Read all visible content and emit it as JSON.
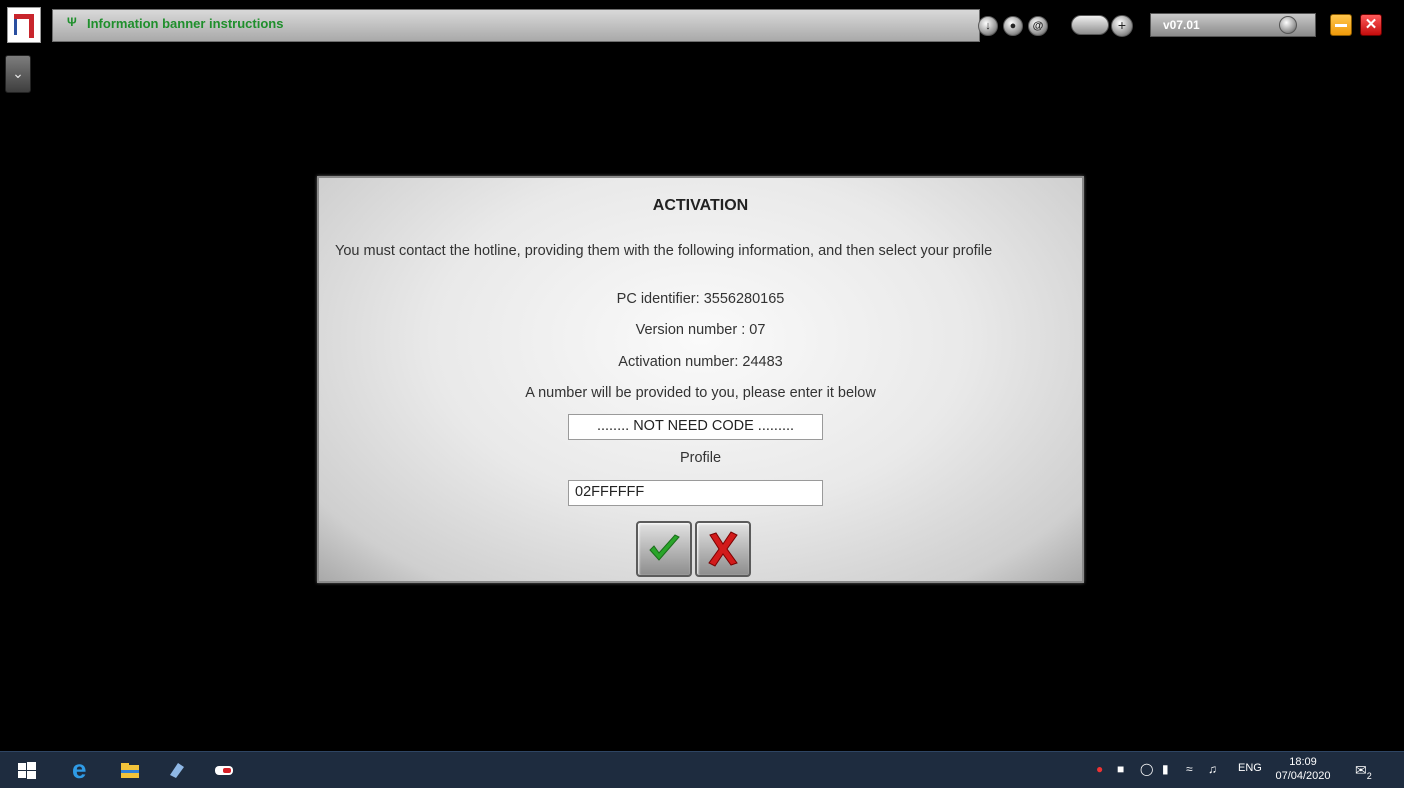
{
  "topbar": {
    "banner_text": "Information banner instructions",
    "version": "v07.01"
  },
  "dialog": {
    "title": "ACTIVATION",
    "message": "You must contact the hotline, providing them with the following information, and then select your profile",
    "pc_identifier": "PC identifier: 3556280165",
    "version_number": "Version number : 07",
    "activation_number": "Activation number: 24483",
    "instruction": "A number will be provided to you, please enter it below",
    "code_value": "........ NOT NEED CODE .........",
    "profile_label": "Profile",
    "profile_value": "02FFFFFF"
  },
  "taskbar": {
    "language": "ENG",
    "time": "18:09",
    "date": "07/04/2020",
    "notification_count": "2"
  }
}
